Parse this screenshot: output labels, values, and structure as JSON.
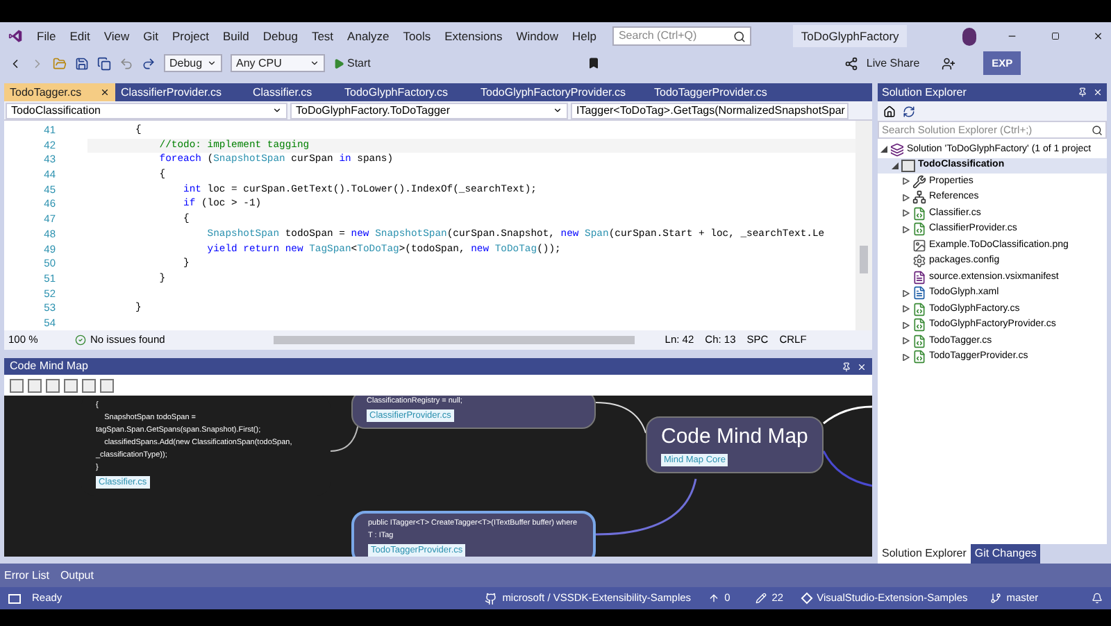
{
  "menu": [
    "File",
    "Edit",
    "View",
    "Git",
    "Project",
    "Build",
    "Debug",
    "Test",
    "Analyze",
    "Tools",
    "Extensions",
    "Window",
    "Help"
  ],
  "search": {
    "placeholder": "Search (Ctrl+Q)"
  },
  "solution_name": "ToDoGlyphFactory",
  "toolbar": {
    "configuration": "Debug",
    "platform": "Any CPU",
    "start": "Start",
    "live_share": "Live Share",
    "badge": "EXP"
  },
  "tabs": [
    {
      "label": "TodoTagger.cs",
      "selected": true
    },
    {
      "label": "ClassifierProvider.cs",
      "selected": false
    },
    {
      "label": "Classifier.cs",
      "selected": false
    },
    {
      "label": "TodoGlyphFactory.cs",
      "selected": false
    },
    {
      "label": "TodoGlyphFactoryProvider.cs",
      "selected": false
    },
    {
      "label": "TodoTaggerProvider.cs",
      "selected": false
    }
  ],
  "nav": [
    "TodoClassification",
    "ToDoGlyphFactory.ToDoTagger",
    "ITagger<ToDoTag>.GetTags(NormalizedSnapshotSpar"
  ],
  "code": [
    {
      "number": "41",
      "tokens": [
        {
          "text": "        {",
          "kind": "plain"
        }
      ]
    },
    {
      "number": "42",
      "tokens": [
        {
          "text": "            //todo: implement tagging",
          "kind": "comment"
        }
      ]
    },
    {
      "number": "43",
      "tokens": [
        {
          "text": "            foreach",
          "kind": "keyword"
        },
        {
          "text": " (",
          "kind": "plain"
        },
        {
          "text": "SnapshotSpan",
          "kind": "type"
        },
        {
          "text": " curSpan ",
          "kind": "plain"
        },
        {
          "text": "in",
          "kind": "keyword"
        },
        {
          "text": " spans)",
          "kind": "plain"
        }
      ]
    },
    {
      "number": "44",
      "tokens": [
        {
          "text": "            {",
          "kind": "plain"
        }
      ]
    },
    {
      "number": "45",
      "tokens": [
        {
          "text": "                int",
          "kind": "keyword"
        },
        {
          "text": " loc = curSpan.GetText().ToLower().IndexOf(_searchText);",
          "kind": "plain"
        }
      ]
    },
    {
      "number": "46",
      "tokens": [
        {
          "text": "                if",
          "kind": "keyword"
        },
        {
          "text": " (loc > -1)",
          "kind": "plain"
        }
      ]
    },
    {
      "number": "47",
      "tokens": [
        {
          "text": "                {",
          "kind": "plain"
        }
      ]
    },
    {
      "number": "48",
      "tokens": [
        {
          "text": "                    SnapshotSpan",
          "kind": "type"
        },
        {
          "text": " todoSpan = ",
          "kind": "plain"
        },
        {
          "text": "new",
          "kind": "keyword"
        },
        {
          "text": " SnapshotSpan",
          "kind": "type"
        },
        {
          "text": "(curSpan.Snapshot, ",
          "kind": "plain"
        },
        {
          "text": "new",
          "kind": "keyword"
        },
        {
          "text": " Span",
          "kind": "type"
        },
        {
          "text": "(curSpan.Start + loc, _searchText.Le",
          "kind": "plain"
        }
      ]
    },
    {
      "number": "49",
      "tokens": [
        {
          "text": "                    yield return new",
          "kind": "keyword"
        },
        {
          "text": " TagSpan",
          "kind": "type"
        },
        {
          "text": "<",
          "kind": "plain"
        },
        {
          "text": "ToDoTag",
          "kind": "type"
        },
        {
          "text": ">(todoSpan, ",
          "kind": "plain"
        },
        {
          "text": "new",
          "kind": "keyword"
        },
        {
          "text": " ToDoTag",
          "kind": "type"
        },
        {
          "text": "());",
          "kind": "plain"
        }
      ]
    },
    {
      "number": "50",
      "tokens": [
        {
          "text": "                }",
          "kind": "plain"
        }
      ]
    },
    {
      "number": "51",
      "tokens": [
        {
          "text": "            }",
          "kind": "plain"
        }
      ]
    },
    {
      "number": "52"
    },
    {
      "number": "53",
      "tokens": [
        {
          "text": "        }",
          "kind": "plain"
        }
      ]
    },
    {
      "number": "54"
    }
  ],
  "editor_status": {
    "zoom": "100 %",
    "issues": "No issues found",
    "line": "Ln: 42",
    "column": "Ch: 13",
    "whitespace": "SPC",
    "line_endings": "CRLF"
  },
  "mind_map": {
    "title": "Code Mind Map",
    "nodes": [
      {
        "kind": "code",
        "selected": false,
        "lines": [
          "{",
          "    SnapshotSpan todoSpan =",
          "tagSpan.Span.GetSpans(span.Snapshot).First();",
          "    classifiedSpans.Add(new ClassificationSpan(todoSpan,",
          "_classificationType));",
          "}"
        ],
        "link": "Classifier.cs"
      },
      {
        "kind": "code",
        "selected": false,
        "lines": [
          "ClassificationRegistry = null;"
        ],
        "link": "ClassifierProvider.cs"
      },
      {
        "kind": "root",
        "selected": false,
        "lines": [
          "Code Mind Map"
        ],
        "link": "Mind Map Core"
      },
      {
        "kind": "code",
        "selected": true,
        "lines": [
          "public ITagger<T> CreateTagger<T>(ITextBuffer buffer) where",
          "T : ITag"
        ],
        "link": "TodoTaggerProvider.cs"
      }
    ]
  },
  "solution_explorer": {
    "title": "Solution Explorer",
    "search": {
      "placeholder": "Search Solution Explorer (Ctrl+;)"
    },
    "tree": [
      {
        "label": "Solution 'ToDoGlyphFactory' (1 of 1 project",
        "kind": "solution",
        "expanded": true,
        "children": [
          {
            "label": "TodoClassification",
            "kind": "project",
            "expanded": true,
            "children": [
              {
                "label": "Properties",
                "kind": "wrench",
                "expanded": false
              },
              {
                "label": "References",
                "kind": "references",
                "expanded": false
              },
              {
                "label": "Classifier.cs",
                "kind": "csharp",
                "expanded": false
              },
              {
                "label": "ClassifierProvider.cs",
                "kind": "csharp",
                "expanded": false
              },
              {
                "label": "Example.ToDoClassification.png",
                "kind": "image"
              },
              {
                "label": "packages.config",
                "kind": "config"
              },
              {
                "label": "source.extension.vsixmanifest",
                "kind": "manifest"
              },
              {
                "label": "TodoGlyph.xaml",
                "kind": "xaml",
                "expanded": false
              },
              {
                "label": "TodoGlyphFactory.cs",
                "kind": "csharp",
                "expanded": false
              },
              {
                "label": "TodoGlyphFactoryProvider.cs",
                "kind": "csharp",
                "expanded": false
              },
              {
                "label": "TodoTagger.cs",
                "kind": "csharp",
                "expanded": false
              },
              {
                "label": "TodoTaggerProvider.cs",
                "kind": "csharp",
                "expanded": false
              }
            ]
          }
        ]
      }
    ],
    "tabs": [
      {
        "label": "Solution Explorer",
        "selected": true
      },
      {
        "label": "Git Changes",
        "selected": false
      }
    ]
  },
  "bottom_tabs": [
    "Error List",
    "Output"
  ],
  "status_bar": {
    "state": "Ready",
    "repository": "microsoft / VSSDK-Extensibility-Samples",
    "push_count": "0",
    "changes_count": "22",
    "project": "VisualStudio-Extension-Samples",
    "branch": "master"
  }
}
